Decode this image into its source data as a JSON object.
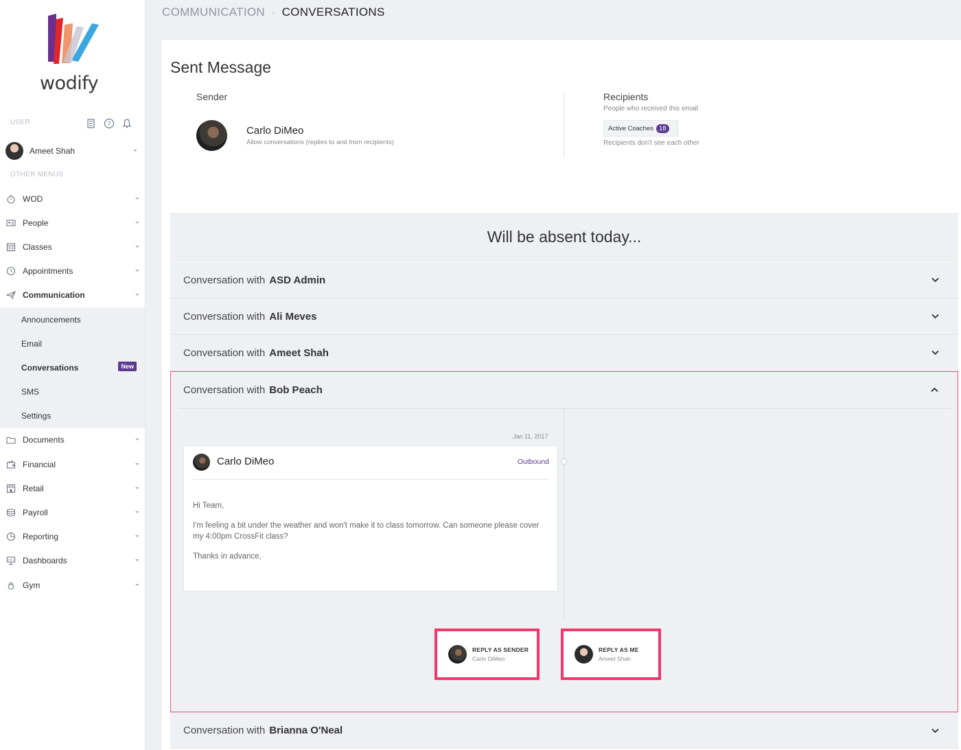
{
  "brand": {
    "name": "wodify"
  },
  "sidebar": {
    "user_section_label": "USER",
    "user_name": "Ameet Shah",
    "other_menus_label": "OTHER MENUS",
    "items": [
      {
        "label": "WOD",
        "icon": "stopwatch-icon"
      },
      {
        "label": "People",
        "icon": "id-card-icon"
      },
      {
        "label": "Classes",
        "icon": "calendar-icon"
      },
      {
        "label": "Appointments",
        "icon": "clock-icon"
      },
      {
        "label": "Communication",
        "icon": "paper-plane-icon"
      },
      {
        "label": "Documents",
        "icon": "folder-icon"
      },
      {
        "label": "Financial",
        "icon": "wallet-icon"
      },
      {
        "label": "Retail",
        "icon": "store-icon"
      },
      {
        "label": "Payroll",
        "icon": "money-stack-icon"
      },
      {
        "label": "Reporting",
        "icon": "pie-chart-icon"
      },
      {
        "label": "Dashboards",
        "icon": "presentation-icon"
      },
      {
        "label": "Gym",
        "icon": "kettlebell-icon"
      }
    ],
    "communication_sub": [
      {
        "label": "Announcements"
      },
      {
        "label": "Email"
      },
      {
        "label": "Conversations",
        "badge": "New"
      },
      {
        "label": "SMS"
      },
      {
        "label": "Settings"
      }
    ]
  },
  "breadcrumb": {
    "parent": "COMMUNICATION",
    "current": "CONVERSATIONS"
  },
  "message": {
    "title": "Sent Message",
    "sender_label": "Sender",
    "sender_name": "Carlo DiMeo",
    "sender_note": "Allow conversations (replies to and from recipients)",
    "recipients_label": "Recipients",
    "recipients_sub": "People who received this email",
    "recipient_group": "Active Coaches",
    "recipient_count": "18",
    "recipients_note": "Recipients don't see each other",
    "subject": "Will be absent today..."
  },
  "conversations": {
    "prefix": "Conversation with",
    "rows": [
      {
        "name": "ASD Admin"
      },
      {
        "name": "Ali Meves"
      },
      {
        "name": "Ameet Shah"
      },
      {
        "name": "Bob Peach"
      },
      {
        "name": "Brianna O'Neal"
      }
    ]
  },
  "thread": {
    "date": "Jan 11, 2017",
    "from": "Carlo DiMeo",
    "direction": "Outbound",
    "body": [
      "Hi Team,",
      "I'm feeling a bit under the weather and won't make it to class tomorrow. Can someone please cover my 4:00pm CrossFit class?",
      "Thanks in advance,"
    ],
    "reply_sender": {
      "title": "REPLY AS SENDER",
      "name": "Carlo DiMeo"
    },
    "reply_me": {
      "title": "REPLY AS ME",
      "name": "Ameet Shah"
    }
  },
  "colors": {
    "accent": "#5b3a8e",
    "highlight": "#f0386b",
    "background": "#eff0f3"
  }
}
